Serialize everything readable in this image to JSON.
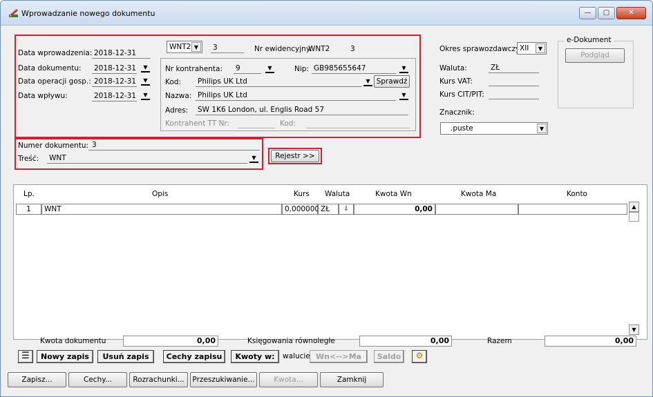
{
  "window": {
    "title": "Wprowadzanie nowego dokumentu",
    "minimize": "—",
    "maximize": "▢",
    "close": "✕"
  },
  "header": {
    "data_wprowadzenia_label": "Data wprowadzenia:",
    "data_wprowadzenia": "2018-12-31",
    "data_dokumentu_label": "Data dokumentu:",
    "data_dokumentu": "2018-12-31",
    "data_operacji_label": "Data operacji gosp.:",
    "data_operacji": "2018-12-31",
    "data_wplywu_label": "Data wpływu:",
    "data_wplywu": "2018-12-31",
    "dd_glyph": "▼",
    "typ": "WNT2",
    "numer": "3",
    "nr_ewid_label": "Nr ewidencyjny:",
    "nr_ewid_typ": "WNT2",
    "nr_ewid_num": "3"
  },
  "kontrahent": {
    "nr_label": "Nr kontrahenta:",
    "nr": "9",
    "nip_label": "Nip:",
    "nip": "GB985655647",
    "kod_label": "Kod:",
    "kod": "Philips UK Ltd",
    "sprawdz": "Sprawdź",
    "nazwa_label": "Nazwa:",
    "nazwa": "Philips UK Ltd",
    "adres_label": "Adres:",
    "adres": "SW 1K6 London, ul. Englis Road 57",
    "tt_label": "Kontrahent TT Nr:",
    "tt_kod_label": "Kod:"
  },
  "right": {
    "okres_label": "Okres sprawozdawczy:",
    "okres": "XII",
    "waluta_label": "Waluta:",
    "waluta": "ZŁ",
    "kurs_vat_label": "Kurs VAT:",
    "kurs_cit_label": "Kurs CIT/PIT:",
    "znacznik_label": "Znacznik:",
    "znacznik": ".puste",
    "edok_title": "e-Dokument",
    "podglad": "Podgląd"
  },
  "doc": {
    "numer_label": "Numer dokumentu:",
    "numer": "3",
    "tresc_label": "Treść:",
    "tresc": "WNT",
    "rejestr": "Rejestr >>"
  },
  "grid": {
    "columns": [
      "Lp.",
      "Opis",
      "Kurs",
      "Waluta",
      "Kwota Wn",
      "Kwota Ma",
      "Konto"
    ],
    "rows": [
      {
        "lp": "1",
        "opis": "WNT",
        "kurs": "0,000000",
        "waluta": "ZŁ",
        "kwota_wn": "0,00",
        "kwota_ma": "",
        "konto": ""
      }
    ]
  },
  "totals": {
    "kwota_dok_label": "Kwota dokumentu",
    "kwota_dok": "0,00",
    "ksieg_label": "Księgowania równoległe",
    "ksieg": "0,00",
    "razem_label": "Razem",
    "razem": "0,00"
  },
  "toolbar": {
    "nowy": "Nowy zapis",
    "usun": "Usuń zapis",
    "cechy_zapisu": "Cechy zapisu",
    "kwoty": "Kwoty w:",
    "walucie": "walucie",
    "wnma": "Wn<-->Ma",
    "saldo": "Saldo"
  },
  "bottom": {
    "zapisz": "Zapisz...",
    "cechy": "Cechy...",
    "rozrachunki": "Rozrachunki...",
    "przeszukiwanie": "Przeszukiwanie...",
    "kwota": "Kwota...",
    "zamknij": "Zamknij"
  }
}
